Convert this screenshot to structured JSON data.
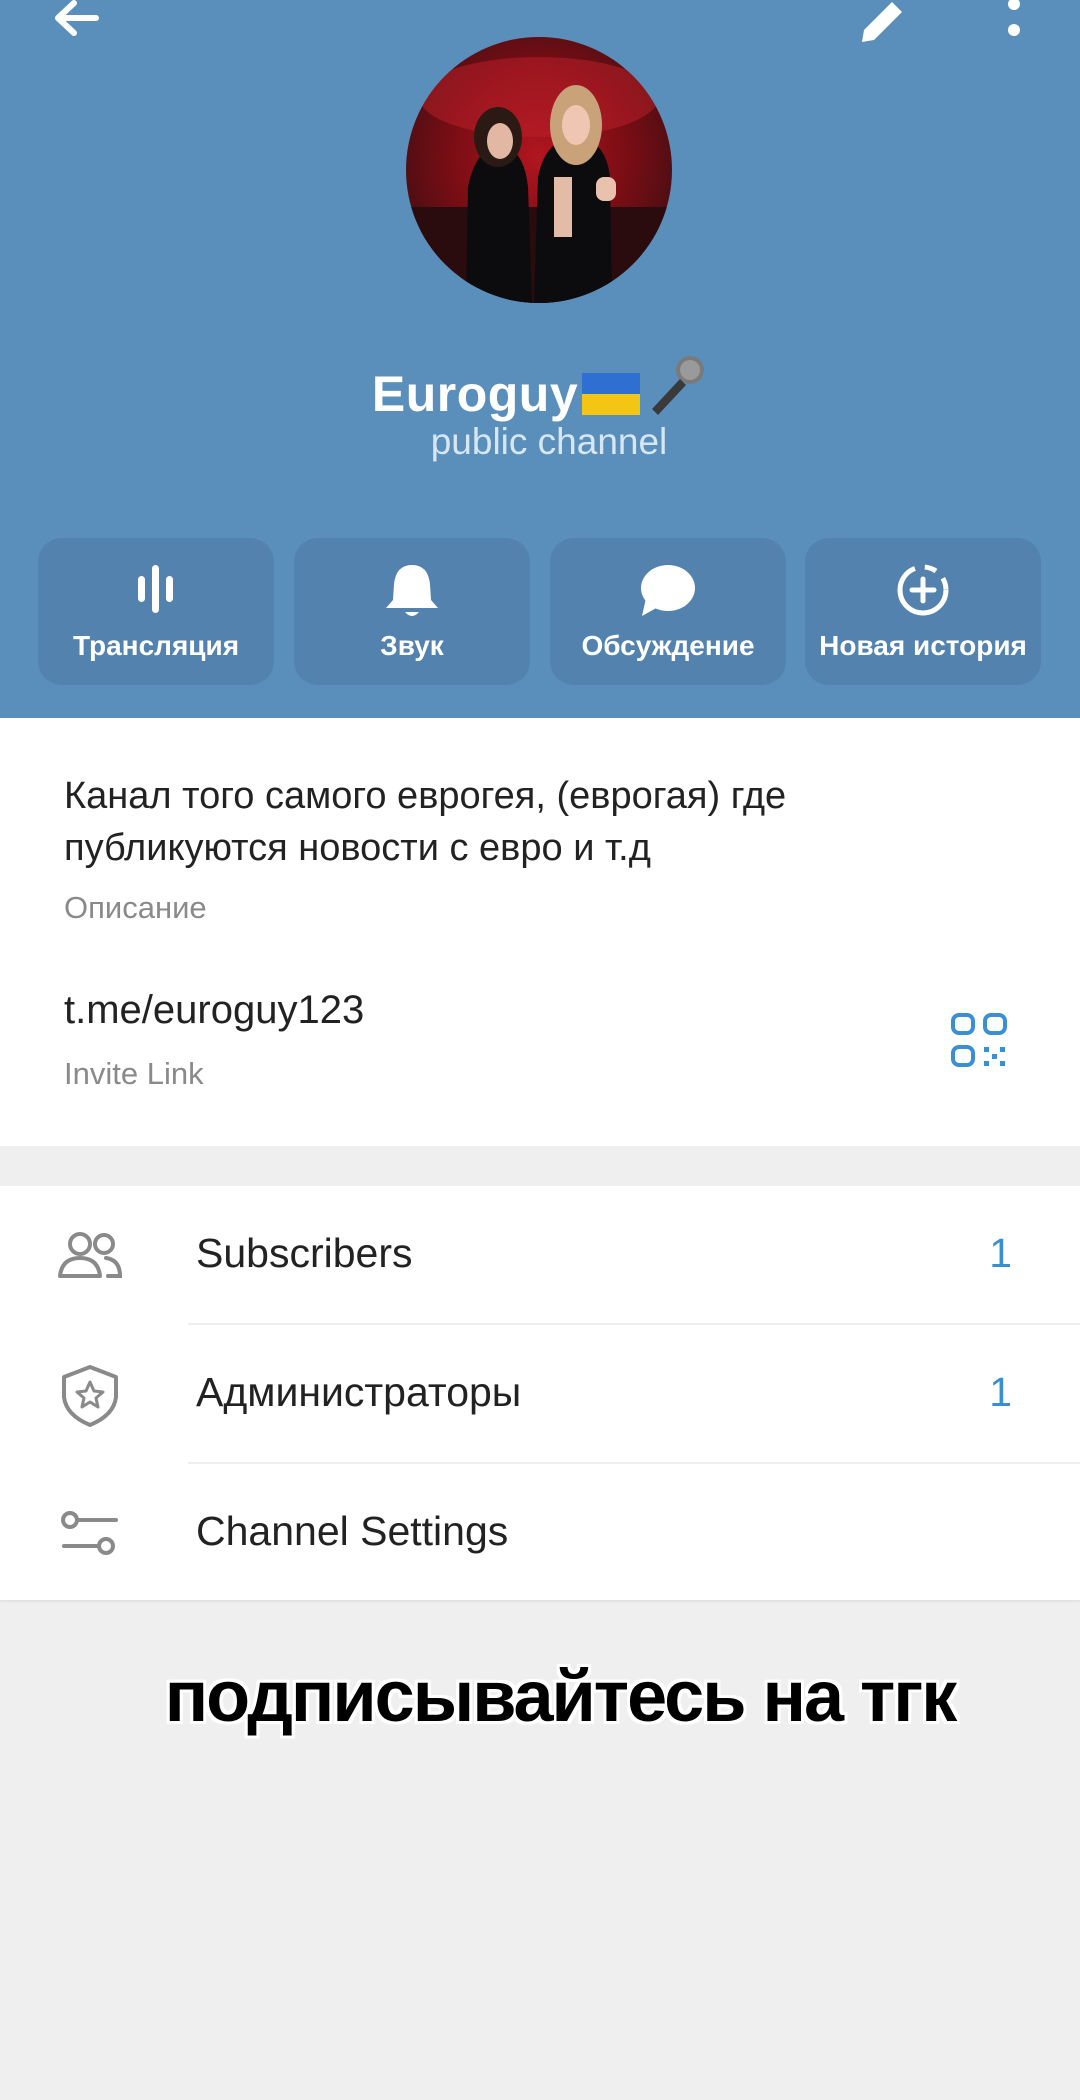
{
  "colors": {
    "header_bg": "#5b8fbb",
    "action_button_bg": "#5282ad",
    "accent": "#3a8fd0"
  },
  "toolbar": {
    "back_icon": "arrow-left-icon",
    "edit_icon": "pencil-icon",
    "more_icon": "more-vertical-icon"
  },
  "profile": {
    "name": "Euroguy",
    "name_emoji": [
      "ukraine-flag",
      "microphone"
    ],
    "status": "public channel"
  },
  "actions": [
    {
      "label": "Трансляция",
      "icon": "live-stream-icon"
    },
    {
      "label": "Звук",
      "icon": "bell-icon"
    },
    {
      "label": "Обсуждение",
      "icon": "chat-bubble-icon"
    },
    {
      "label": "Новая история",
      "icon": "add-story-icon"
    }
  ],
  "info": {
    "description": "Канал того самого еврогея, (еврогая) где публикуются новости с евро и т.д",
    "description_label": "Описание",
    "link": "t.me/euroguy123",
    "link_label": "Invite Link",
    "qr_icon": "qr-code-icon"
  },
  "menu": [
    {
      "label": "Subscribers",
      "value": "1",
      "icon": "users-icon"
    },
    {
      "label": "Администраторы",
      "value": "1",
      "icon": "shield-star-icon"
    },
    {
      "label": "Channel Settings",
      "value": "",
      "icon": "settings-sliders-icon"
    }
  ],
  "caption": "подписывайтесь на тгк"
}
